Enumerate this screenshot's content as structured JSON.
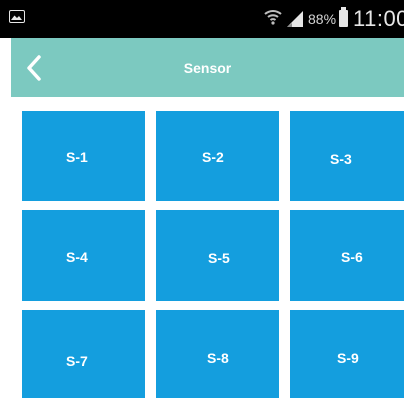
{
  "statusbar": {
    "battery_percent": "88%",
    "time": "11:00",
    "icons": [
      "image-icon",
      "wifi-icon",
      "signal-icon",
      "battery-icon"
    ]
  },
  "header": {
    "title": "Sensor",
    "back_icon": "chevron-left-icon",
    "color": "#7cc9c0"
  },
  "sensors": [
    {
      "label": "S-1"
    },
    {
      "label": "S-2"
    },
    {
      "label": "S-3"
    },
    {
      "label": "S-4"
    },
    {
      "label": "S-5"
    },
    {
      "label": "S-6"
    },
    {
      "label": "S-7"
    },
    {
      "label": "S-8"
    },
    {
      "label": "S-9"
    }
  ],
  "tile_color": "#149ede"
}
